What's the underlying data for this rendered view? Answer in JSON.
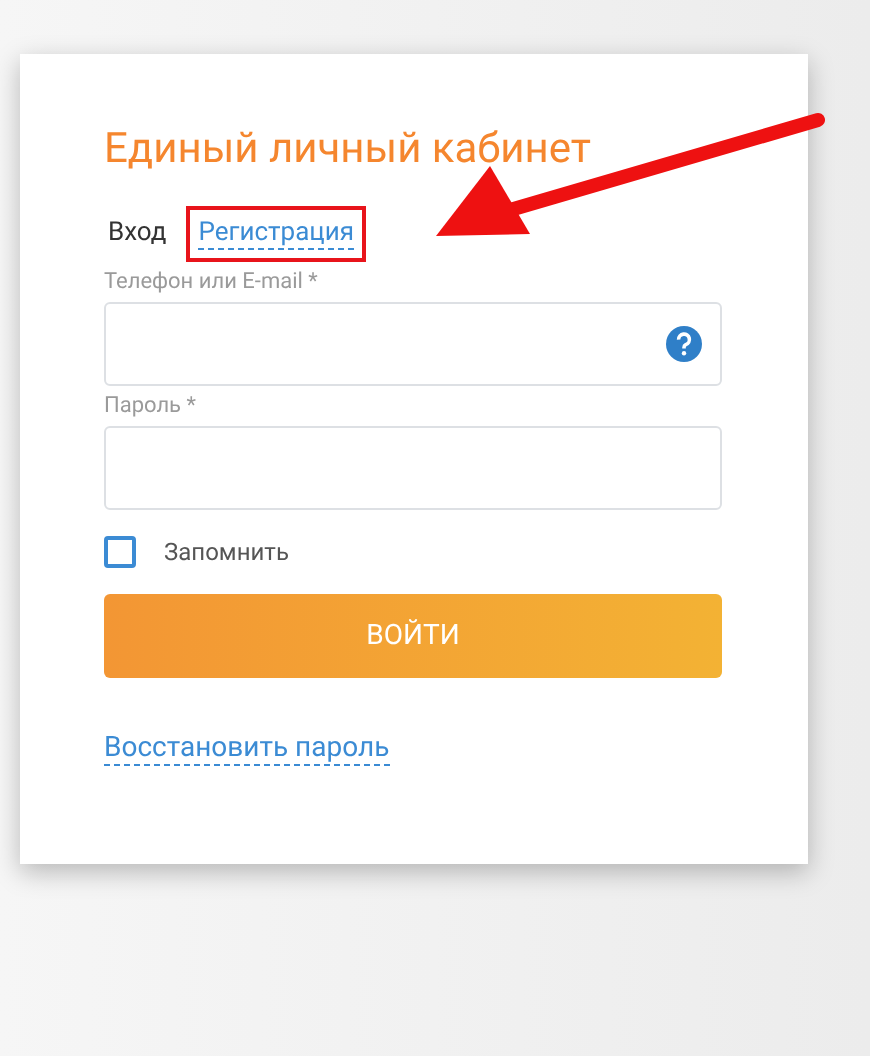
{
  "title": "Единый личный кабинет",
  "tabs": [
    {
      "label": "Вход",
      "selected": true,
      "highlighted": false
    },
    {
      "label": "Регистрация",
      "selected": false,
      "highlighted": true
    }
  ],
  "fields": [
    {
      "label": "Телефон или E-mail *",
      "help": true
    },
    {
      "label": "Пароль *",
      "help": false
    }
  ],
  "remember": {
    "label": "Запомнить",
    "checked": false
  },
  "submit": "ВОЙТИ",
  "recover_link": "Восстановить пароль"
}
